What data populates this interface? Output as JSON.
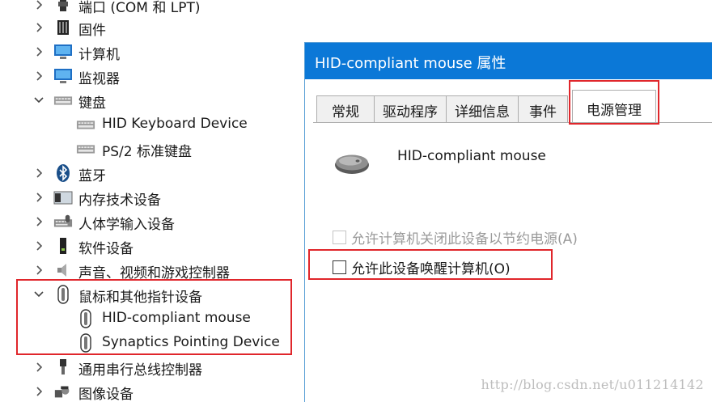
{
  "tree": {
    "items": [
      {
        "label": "端口 (COM 和 LPT)",
        "icon": "port-icon",
        "level": 0,
        "state": "collapsed"
      },
      {
        "label": "固件",
        "icon": "firmware-icon",
        "level": 0,
        "state": "collapsed"
      },
      {
        "label": "计算机",
        "icon": "computer-icon",
        "level": 0,
        "state": "collapsed"
      },
      {
        "label": "监视器",
        "icon": "monitor-icon",
        "level": 0,
        "state": "collapsed"
      },
      {
        "label": "键盘",
        "icon": "keyboard-icon",
        "level": 0,
        "state": "expanded"
      },
      {
        "label": "HID Keyboard Device",
        "icon": "keyboard-icon",
        "level": 1
      },
      {
        "label": "PS/2 标准键盘",
        "icon": "keyboard-icon",
        "level": 1
      },
      {
        "label": "蓝牙",
        "icon": "bluetooth-icon",
        "level": 0,
        "state": "collapsed"
      },
      {
        "label": "内存技术设备",
        "icon": "memory-icon",
        "level": 0,
        "state": "collapsed"
      },
      {
        "label": "人体学输入设备",
        "icon": "hid-icon",
        "level": 0,
        "state": "collapsed"
      },
      {
        "label": "软件设备",
        "icon": "software-device-icon",
        "level": 0,
        "state": "collapsed"
      },
      {
        "label": "声音、视频和游戏控制器",
        "icon": "speaker-icon",
        "level": 0,
        "state": "collapsed"
      },
      {
        "label": "鼠标和其他指针设备",
        "icon": "mouse-icon",
        "level": 0,
        "state": "expanded"
      },
      {
        "label": "HID-compliant mouse",
        "icon": "mouse-icon",
        "level": 1
      },
      {
        "label": "Synaptics Pointing Device",
        "icon": "mouse-icon",
        "level": 1
      },
      {
        "label": "通用串行总线控制器",
        "icon": "usb-icon",
        "level": 0,
        "state": "collapsed"
      },
      {
        "label": "图像设备",
        "icon": "camera-icon",
        "level": 0,
        "state": "collapsed"
      }
    ]
  },
  "dialog": {
    "title": "HID-compliant mouse 属性",
    "tabs": [
      {
        "label": "常规"
      },
      {
        "label": "驱动程序"
      },
      {
        "label": "详细信息"
      },
      {
        "label": "事件"
      },
      {
        "label": "电源管理",
        "active": true
      }
    ],
    "device_name": "HID-compliant mouse",
    "options": [
      {
        "label": "允许计算机关闭此设备以节约电源(A)",
        "checked": false,
        "enabled": false
      },
      {
        "label": "允许此设备唤醒计算机(O)",
        "checked": false,
        "enabled": true
      }
    ]
  },
  "watermark": "http://blog.csdn.net/u011214142",
  "colors": {
    "titlebar": "#0b78d7",
    "highlight": "#e0262b"
  }
}
